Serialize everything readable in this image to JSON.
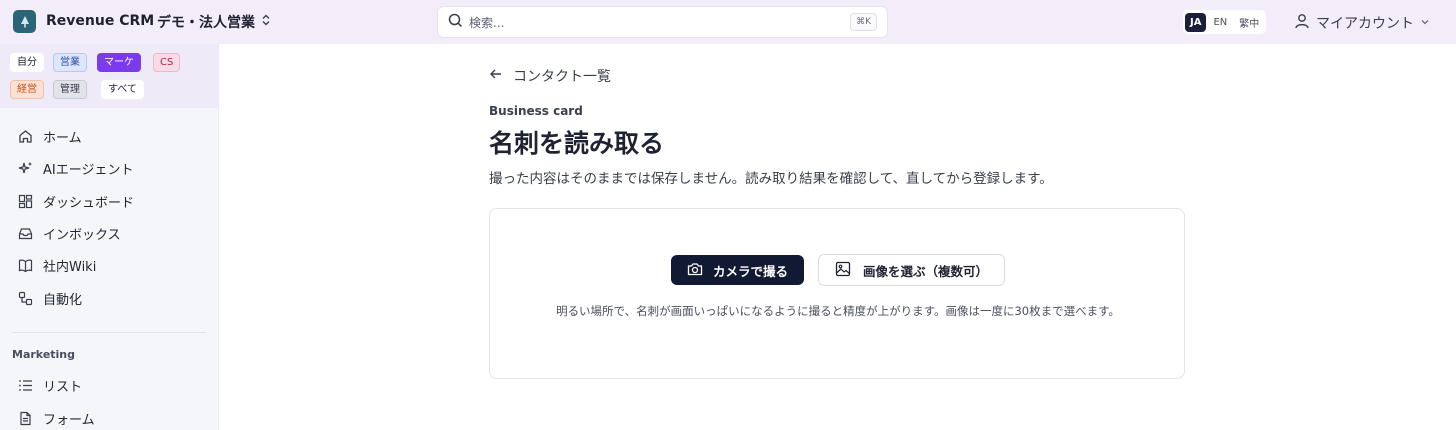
{
  "header": {
    "app_name": "Revenue CRM",
    "workspace": "デモ・法人営業",
    "search_placeholder": "検索...",
    "search_shortcut": "⌘K",
    "languages": [
      "JA",
      "EN",
      "繁中"
    ],
    "active_language": "JA",
    "account_label": "マイアカウント"
  },
  "sidebar": {
    "roles": [
      "自分",
      "営業",
      "マーケ",
      "CS",
      "経営",
      "管理",
      "すべて"
    ],
    "active_role": "マーケ",
    "nav": [
      "ホーム",
      "AIエージェント",
      "ダッシュボード",
      "インボックス",
      "社内Wiki",
      "自動化"
    ],
    "section_label": "Marketing",
    "section_items": [
      "リスト",
      "フォーム"
    ]
  },
  "main": {
    "back_label": "コンタクト一覧",
    "eyebrow": "Business card",
    "title": "名刺を読み取る",
    "description": "撮った内容はそのままでは保存しません。読み取り結果を確認して、直してから登録します。",
    "camera_button": "カメラで撮る",
    "image_button": "画像を選ぶ（複数可）",
    "hint": "明るい場所で、名刺が画面いっぱいになるように撮ると精度が上がります。画像は一度に30枚まで選べます。"
  },
  "colors": {
    "header_bg": "#f3edf9",
    "primary_button": "#121a33",
    "active_chip": "#7c3aed",
    "brand_logo": "#2b6478"
  }
}
